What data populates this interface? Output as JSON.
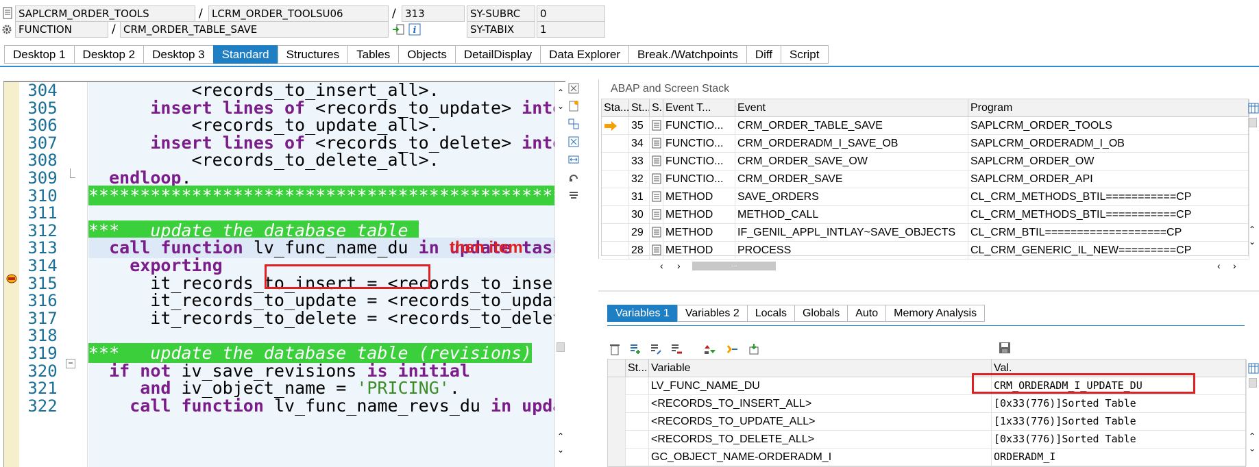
{
  "header": {
    "program": "SAPLCRM_ORDER_TOOLS",
    "include": "LCRM_ORDER_TOOLSU06",
    "line": "313",
    "event_type": "FUNCTION",
    "event": "CRM_ORDER_TABLE_SAVE",
    "sy_subrc_label": "SY-SUBRC",
    "sy_subrc_value": "0",
    "sy_tabix_label": "SY-TABIX",
    "sy_tabix_value": "1",
    "slash": "/"
  },
  "tabs": [
    "Desktop 1",
    "Desktop 2",
    "Desktop 3",
    "Standard",
    "Structures",
    "Tables",
    "Objects",
    "DetailDisplay",
    "Data Explorer",
    "Break./Watchpoints",
    "Diff",
    "Script"
  ],
  "code": {
    "lines": [
      {
        "no": "304",
        "text": "          <records_to_insert_all>."
      },
      {
        "no": "305",
        "kw": "insert lines of",
        "pre": "      ",
        "rest": " <records_to_update> ",
        "kw2": "into"
      },
      {
        "no": "306",
        "text": "          <records_to_update_all>."
      },
      {
        "no": "307",
        "kw": "insert lines of",
        "pre": "      ",
        "rest": " <records_to_delete> ",
        "kw2": "into"
      },
      {
        "no": "308",
        "text": "          <records_to_delete_all>."
      },
      {
        "no": "309",
        "kw": "endloop",
        "pre": "  ",
        "rest": "."
      },
      {
        "no": "310",
        "bar": "**********************************************"
      },
      {
        "no": "311",
        "text": ""
      },
      {
        "no": "312",
        "comment": "***   update the database table "
      },
      {
        "no": "313",
        "kw": "call function",
        "pre": "  ",
        "rest": " lv_func_name_du ",
        "kw2": "in update task"
      },
      {
        "no": "314",
        "kw": "exporting",
        "pre": "    ",
        "rest": ""
      },
      {
        "no": "315",
        "text": "      it_records_to_insert = <records_to_insert_all>"
      },
      {
        "no": "316",
        "text": "      it_records_to_update = <records_to_update_all>"
      },
      {
        "no": "317",
        "text": "      it_records_to_delete = <records_to_delete_all>"
      },
      {
        "no": "318",
        "text": ""
      },
      {
        "no": "319",
        "comment": "***   update the database table (revisions)"
      },
      {
        "no": "320",
        "kw": "if not",
        "pre": "  ",
        "rest": " iv_save_revisions ",
        "kw2": "is initial"
      },
      {
        "no": "321",
        "kw": "and",
        "pre": "     ",
        "rest": " iv_object_name = ",
        "str": "'PRICING'",
        "tail": "."
      },
      {
        "no": "322",
        "kw": "call function",
        "pre": "    ",
        "rest": " lv_func_name_revs_du ",
        "kw2": "in update task"
      }
    ],
    "annotation": "then item"
  },
  "stack": {
    "title": "ABAP and Screen Stack",
    "columns": [
      "Sta...",
      "St...",
      "S...",
      "Event T...",
      "Event",
      "Program"
    ],
    "rows": [
      {
        "st": "35",
        "type": "FUNCTIO...",
        "event": "CRM_ORDER_TABLE_SAVE",
        "program": "SAPLCRM_ORDER_TOOLS",
        "current": true
      },
      {
        "st": "34",
        "type": "FUNCTIO...",
        "event": "CRM_ORDERADM_I_SAVE_OB",
        "program": "SAPLCRM_ORDERADM_I_OB"
      },
      {
        "st": "33",
        "type": "FUNCTIO...",
        "event": "CRM_ORDER_SAVE_OW",
        "program": "SAPLCRM_ORDER_OW"
      },
      {
        "st": "32",
        "type": "FUNCTIO...",
        "event": "CRM_ORDER_SAVE",
        "program": "SAPLCRM_ORDER_API"
      },
      {
        "st": "31",
        "type": "METHOD",
        "event": "SAVE_ORDERS",
        "program": "CL_CRM_METHODS_BTIL===========CP"
      },
      {
        "st": "30",
        "type": "METHOD",
        "event": "METHOD_CALL",
        "program": "CL_CRM_METHODS_BTIL===========CP"
      },
      {
        "st": "29",
        "type": "METHOD",
        "event": "IF_GENIL_APPL_INTLAY~SAVE_OBJECTS",
        "program": "CL_CRM_BTIL===================CP"
      },
      {
        "st": "28",
        "type": "METHOD",
        "event": "PROCESS",
        "program": "CL_CRM_GENERIC_IL_NEW=========CP"
      }
    ],
    "scroll_thumb": "..."
  },
  "vars": {
    "tabs": [
      "Variables 1",
      "Variables 2",
      "Locals",
      "Globals",
      "Auto",
      "Memory Analysis"
    ],
    "columns": [
      "St...",
      "Variable",
      "Val."
    ],
    "rows": [
      {
        "name": "LV_FUNC_NAME_DU",
        "value": "CRM_ORDERADM_I_UPDATE_DU"
      },
      {
        "name": "<RECORDS_TO_INSERT_ALL>",
        "value": "[0x33(776)]Sorted Table"
      },
      {
        "name": "<RECORDS_TO_UPDATE_ALL>",
        "value": "[1x33(776)]Sorted Table"
      },
      {
        "name": "<RECORDS_TO_DELETE_ALL>",
        "value": "[0x33(776)]Sorted Table"
      },
      {
        "name": "GC_OBJECT_NAME-ORDERADM_I",
        "value": "ORDERADM_I"
      }
    ]
  },
  "colors": {
    "accent": "#1f7fc4",
    "keyword": "#7a1c8a",
    "comment_bg": "#3bcf3b",
    "annotation": "#e02020"
  }
}
